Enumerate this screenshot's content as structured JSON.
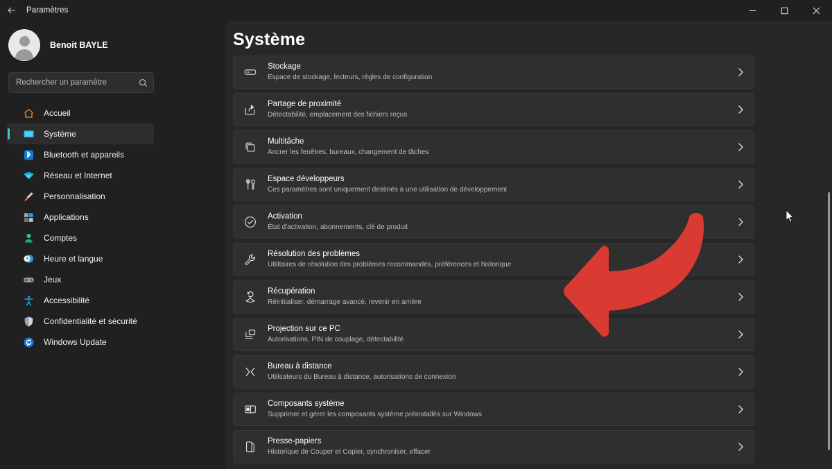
{
  "window": {
    "app_title": "Paramètres",
    "back_icon": "arrow-left-icon",
    "controls": [
      {
        "name": "minimize",
        "icon": "minimize-icon"
      },
      {
        "name": "maximize",
        "icon": "maximize-icon"
      },
      {
        "name": "close",
        "icon": "close-icon"
      }
    ]
  },
  "sidebar": {
    "account": {
      "name": "Benoit BAYLE",
      "avatar_icon": "user-avatar-icon"
    },
    "search": {
      "placeholder": "Rechercher un paramètre",
      "value": "",
      "icon": "search-icon"
    },
    "items": [
      {
        "label": "Accueil",
        "icon": "home-icon",
        "selected": false
      },
      {
        "label": "Système",
        "icon": "monitor-icon",
        "selected": true
      },
      {
        "label": "Bluetooth et appareils",
        "icon": "bluetooth-icon",
        "selected": false
      },
      {
        "label": "Réseau et Internet",
        "icon": "wifi-icon",
        "selected": false
      },
      {
        "label": "Personnalisation",
        "icon": "paintbrush-icon",
        "selected": false
      },
      {
        "label": "Applications",
        "icon": "apps-icon",
        "selected": false
      },
      {
        "label": "Comptes",
        "icon": "account-icon",
        "selected": false
      },
      {
        "label": "Heure et langue",
        "icon": "clock-globe-icon",
        "selected": false
      },
      {
        "label": "Jeux",
        "icon": "gamepad-icon",
        "selected": false
      },
      {
        "label": "Accessibilité",
        "icon": "accessibility-icon",
        "selected": false
      },
      {
        "label": "Confidentialité et sécurité",
        "icon": "shield-icon",
        "selected": false
      },
      {
        "label": "Windows Update",
        "icon": "update-icon",
        "selected": false
      }
    ]
  },
  "main": {
    "title": "Système",
    "rows": [
      {
        "title": "Stockage",
        "subtitle": "Espace de stockage, lecteurs, règles de configuration",
        "icon": "drive-icon"
      },
      {
        "title": "Partage de proximité",
        "subtitle": "Détectabilité, emplacement des fichiers reçus",
        "icon": "share-icon"
      },
      {
        "title": "Multitâche",
        "subtitle": "Ancrer les fenêtres, bureaux, changement de tâches",
        "icon": "windows-stack-icon"
      },
      {
        "title": "Espace développeurs",
        "subtitle": "Ces paramètres sont uniquement destinés à une utilisation de développement",
        "icon": "tools-icon"
      },
      {
        "title": "Activation",
        "subtitle": "État d'activation, abonnements, clé de produit",
        "icon": "check-circle-icon"
      },
      {
        "title": "Résolution des problèmes",
        "subtitle": "Utilitaires de résolution des problèmes recommandés, préférences et historique",
        "icon": "wrench-icon"
      },
      {
        "title": "Récupération",
        "subtitle": "Réinitialiser, démarrage avancé, revenir en arrière",
        "icon": "recovery-icon"
      },
      {
        "title": "Projection sur ce PC",
        "subtitle": "Autorisations, PIN de couplage, détectabilité",
        "icon": "projection-icon"
      },
      {
        "title": "Bureau à distance",
        "subtitle": "Utilisateurs du Bureau à distance, autorisations de connexion",
        "icon": "remote-desktop-icon"
      },
      {
        "title": "Composants système",
        "subtitle": "Supprimer et gérer les composants système préinstallés sur Windows",
        "icon": "components-icon"
      },
      {
        "title": "Presse-papiers",
        "subtitle": "Historique de Couper et Copier, synchroniser, effacer",
        "icon": "clipboard-icon"
      }
    ],
    "chevron_icon": "chevron-right-icon"
  },
  "annotation": {
    "type": "curved-arrow-left",
    "color": "#d93a32",
    "points_at": "Récupération"
  },
  "cursor": {
    "icon": "mouse-pointer-icon"
  },
  "colors": {
    "page_bg": "#202020",
    "panel_bg": "#272727",
    "card_bg": "#2f2f2f",
    "accent": "#4cc2ce",
    "annotation_red": "#d93a32"
  }
}
